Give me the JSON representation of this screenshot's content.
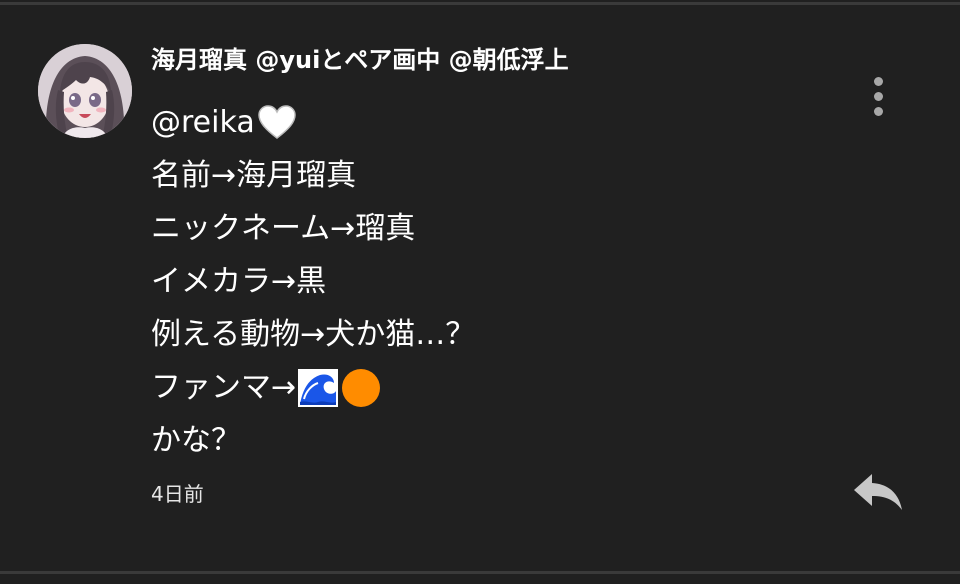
{
  "comment": {
    "author": "海月瑠真 @yuiとペア画中 @朝低浮上",
    "lines": [
      "@reika",
      "名前→海月瑠真",
      "ニックネーム→瑠真",
      "イメカラ→黒",
      "例える動物→犬か猫…？",
      "ファンマ→",
      "かな？"
    ],
    "emojis": {
      "line1": "white-heart",
      "line6": [
        "water-wave",
        "orange-circle"
      ]
    },
    "timestamp": "4日前"
  },
  "icons": {
    "menu": "more-vertical-icon",
    "reply": "reply-icon"
  },
  "colors": {
    "background": "#202020",
    "text": "#ffffff",
    "icon": "#a8a8a8",
    "orange_emoji": "#ff8c00",
    "wave_emoji": "#1565ff"
  }
}
